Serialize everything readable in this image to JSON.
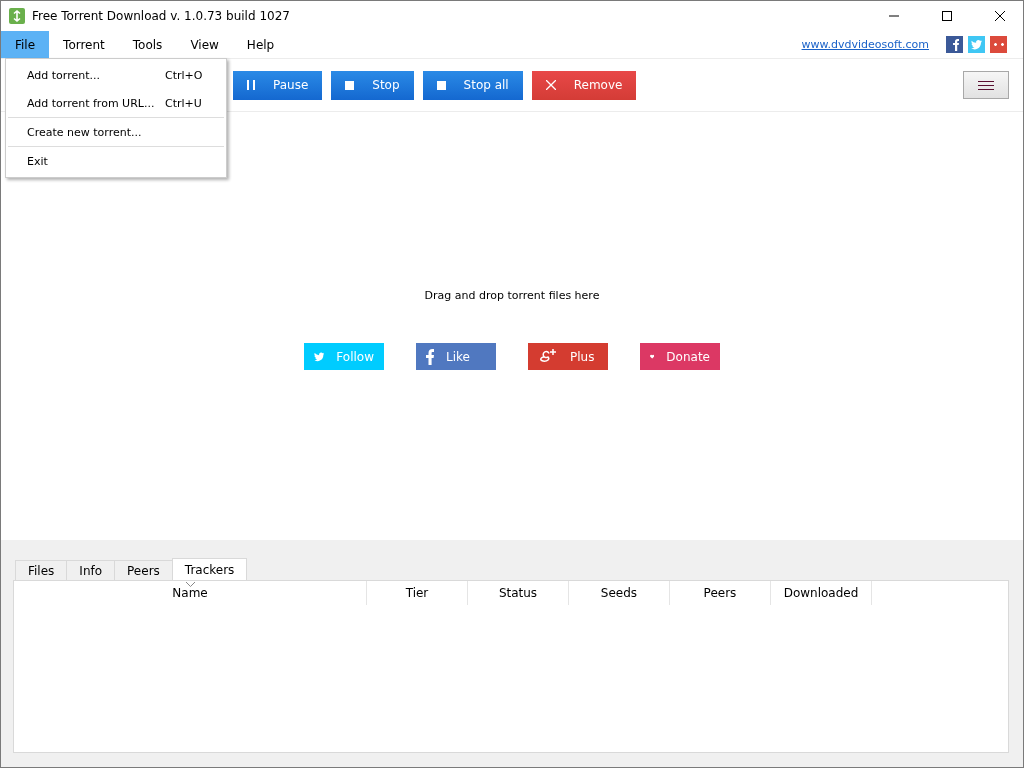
{
  "window": {
    "title": "Free Torrent Download v. 1.0.73 build 1027"
  },
  "menu": [
    {
      "label": "File",
      "selected": true
    },
    {
      "label": "Torrent",
      "selected": false
    },
    {
      "label": "Tools",
      "selected": false
    },
    {
      "label": "View",
      "selected": false
    },
    {
      "label": "Help",
      "selected": false
    }
  ],
  "site_link": "www.dvdvideosoft.com",
  "social_icons": [
    {
      "kind": "facebook"
    },
    {
      "kind": "twitter"
    },
    {
      "kind": "google"
    }
  ],
  "file_menu": [
    {
      "label": "Add torrent...",
      "shortcut": "Ctrl+O",
      "separator_after": false
    },
    {
      "label": "Add torrent from URL...",
      "shortcut": "Ctrl+U",
      "separator_after": true
    },
    {
      "label": "Create new torrent...",
      "separator_after": true
    },
    {
      "label": "Exit",
      "separator_after": false
    }
  ],
  "toolbar": [
    {
      "kind": "pause",
      "label": "Pause"
    },
    {
      "kind": "stop",
      "label": "Stop"
    },
    {
      "kind": "stop",
      "label": "Stop all"
    },
    {
      "kind": "remove",
      "label": "Remove"
    }
  ],
  "drop_hint": "Drag and drop torrent files here",
  "social_buttons": [
    {
      "kind": "twitter",
      "label": "Follow",
      "color": "#00ccff"
    },
    {
      "kind": "facebook",
      "label": "Like",
      "color": "#5078c0"
    },
    {
      "kind": "google",
      "label": "Plus",
      "color": "#d43c30"
    },
    {
      "kind": "heart",
      "label": "Donate",
      "color": "#dc3864"
    }
  ],
  "tabs": [
    {
      "label": "Files",
      "selected": false
    },
    {
      "label": "Info",
      "selected": false
    },
    {
      "label": "Peers",
      "selected": false
    },
    {
      "label": "Trackers",
      "selected": true
    }
  ],
  "table": {
    "columns": [
      {
        "label": "Name",
        "sorted": true
      },
      {
        "label": "Tier",
        "sorted": false
      },
      {
        "label": "Status",
        "sorted": false
      },
      {
        "label": "Seeds",
        "sorted": false
      },
      {
        "label": "Peers",
        "sorted": false
      },
      {
        "label": "Downloaded",
        "sorted": false
      }
    ]
  }
}
